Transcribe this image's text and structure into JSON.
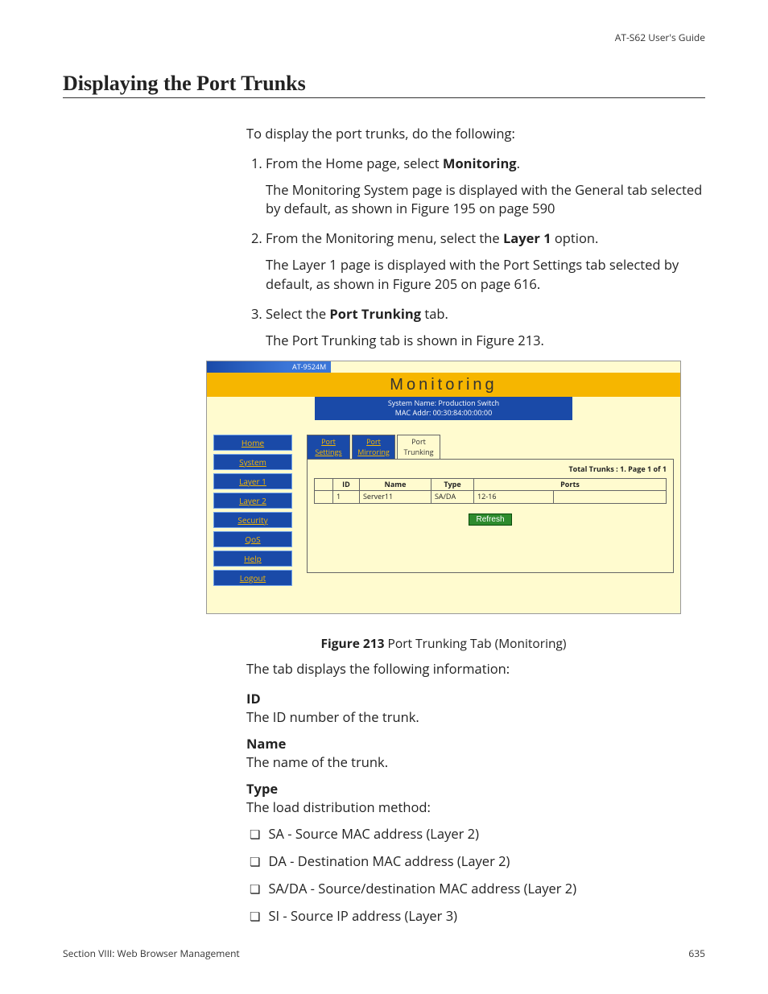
{
  "header": {
    "guide_name": "AT-S62 User's Guide"
  },
  "title": "Displaying the Port Trunks",
  "intro": "To display the port trunks, do the following:",
  "steps": [
    {
      "lead": "From the Home page, select ",
      "bold": "Monitoring",
      "tail": ".",
      "followup": "The Monitoring System page is displayed with the General tab selected by default, as shown in Figure 195 on page 590"
    },
    {
      "lead": "From the Monitoring menu, select the ",
      "bold": "Layer 1",
      "tail": " option.",
      "followup": "The Layer 1 page is displayed with the Port Settings tab selected by default, as shown in Figure 205 on page 616."
    },
    {
      "lead": "Select the ",
      "bold": "Port Trunking",
      "tail": " tab.",
      "followup": "The Port Trunking tab is shown in Figure 213."
    }
  ],
  "figure": {
    "device": "AT-9524M",
    "heading_text": "Monitoring",
    "sys_name": "System Name: Production Switch",
    "mac": "MAC Addr: 00:30:84:00:00:00",
    "sidebar": [
      "Home",
      "System",
      "Layer 1",
      "Layer 2",
      "Security",
      "QoS",
      "Help",
      "Logout"
    ],
    "tabs": [
      {
        "label_line1": "Port",
        "label_line2": "Settings",
        "active": false
      },
      {
        "label_line1": "Port",
        "label_line2": "Mirroring",
        "active": false
      },
      {
        "label_line1": "Port",
        "label_line2": "Trunking",
        "active": true
      }
    ],
    "total_label": "Total Trunks : 1. Page 1 of 1",
    "columns": [
      "",
      "ID",
      "Name",
      "Type",
      "Ports"
    ],
    "row": {
      "id": "1",
      "name": "Server11",
      "type": "SA/DA",
      "ports": "12-16"
    },
    "refresh": "Refresh",
    "caption_bold": "Figure 213",
    "caption_rest": "  Port Trunking Tab (Monitoring)"
  },
  "after_figure_intro": "The tab displays the following information:",
  "definitions": [
    {
      "term": "ID",
      "desc": "The ID number of the trunk."
    },
    {
      "term": "Name",
      "desc": "The name of the trunk."
    },
    {
      "term": "Type",
      "desc": "The load distribution method:"
    }
  ],
  "type_list": [
    "SA - Source MAC address (Layer 2)",
    "DA - Destination MAC address (Layer 2)",
    "SA/DA - Source/destination MAC address (Layer 2)",
    "SI - Source IP address (Layer 3)"
  ],
  "footer": {
    "left": "Section VIII: Web Browser Management",
    "right": "635"
  }
}
